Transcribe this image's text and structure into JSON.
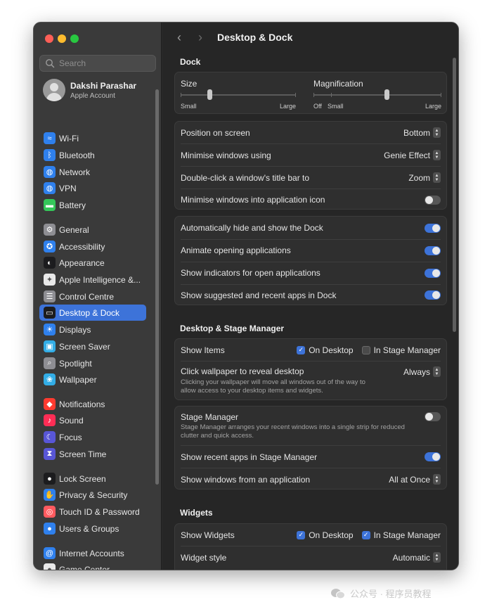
{
  "sidebar": {
    "search_placeholder": "Search",
    "account": {
      "name": "Dakshi Parashar",
      "subtitle": "Apple Account"
    },
    "items": [
      {
        "label": "Wi-Fi",
        "icon": "wifi-icon",
        "color": "#2f80ed"
      },
      {
        "label": "Bluetooth",
        "icon": "bluetooth-icon",
        "color": "#2f80ed"
      },
      {
        "label": "Network",
        "icon": "globe-icon",
        "color": "#2f80ed"
      },
      {
        "label": "VPN",
        "icon": "vpn-globe-icon",
        "color": "#2f80ed"
      },
      {
        "label": "Battery",
        "icon": "battery-icon",
        "color": "#34c759"
      },
      {
        "label": "General",
        "icon": "gear-icon",
        "color": "#8e8e93"
      },
      {
        "label": "Accessibility",
        "icon": "accessibility-icon",
        "color": "#2f80ed"
      },
      {
        "label": "Appearance",
        "icon": "appearance-icon",
        "color": "#1c1c1e"
      },
      {
        "label": "Apple Intelligence &...",
        "icon": "apple-intelligence-icon",
        "color": "#e9e9e9"
      },
      {
        "label": "Control Centre",
        "icon": "control-centre-icon",
        "color": "#8e8e93"
      },
      {
        "label": "Desktop & Dock",
        "icon": "dock-icon",
        "color": "#1c1c1e",
        "selected": true
      },
      {
        "label": "Displays",
        "icon": "sun-icon",
        "color": "#2f80ed"
      },
      {
        "label": "Screen Saver",
        "icon": "screen-saver-icon",
        "color": "#32ade6"
      },
      {
        "label": "Spotlight",
        "icon": "spotlight-icon",
        "color": "#8e8e93"
      },
      {
        "label": "Wallpaper",
        "icon": "wallpaper-icon",
        "color": "#32ade6"
      },
      {
        "label": "Notifications",
        "icon": "bell-icon",
        "color": "#ff3b30"
      },
      {
        "label": "Sound",
        "icon": "speaker-icon",
        "color": "#ff2d55"
      },
      {
        "label": "Focus",
        "icon": "moon-icon",
        "color": "#5856d6"
      },
      {
        "label": "Screen Time",
        "icon": "hourglass-icon",
        "color": "#5856d6"
      },
      {
        "label": "Lock Screen",
        "icon": "lock-icon",
        "color": "#1c1c1e"
      },
      {
        "label": "Privacy & Security",
        "icon": "hand-icon",
        "color": "#2f80ed"
      },
      {
        "label": "Touch ID & Password",
        "icon": "fingerprint-icon",
        "color": "#ff5a5f"
      },
      {
        "label": "Users & Groups",
        "icon": "users-icon",
        "color": "#2f80ed"
      },
      {
        "label": "Internet Accounts",
        "icon": "at-icon",
        "color": "#2f80ed"
      },
      {
        "label": "Game Center",
        "icon": "game-center-icon",
        "color": "#e9e9e9"
      }
    ]
  },
  "main": {
    "title": "Desktop & Dock",
    "dock": {
      "title": "Dock",
      "size": {
        "label": "Size",
        "min": "Small",
        "max": "Large",
        "value": 0.25
      },
      "magnification": {
        "label": "Magnification",
        "off": "Off",
        "min": "Small",
        "max": "Large",
        "value": 0.57
      },
      "position": {
        "label": "Position on screen",
        "value": "Bottom"
      },
      "minimise_using": {
        "label": "Minimise windows using",
        "value": "Genie Effect"
      },
      "double_click": {
        "label": "Double-click a window's title bar to",
        "value": "Zoom"
      },
      "minimise_into_icon": {
        "label": "Minimise windows into application icon",
        "on": false
      },
      "auto_hide": {
        "label": "Automatically hide and show the Dock",
        "on": true
      },
      "animate": {
        "label": "Animate opening applications",
        "on": true
      },
      "indicators": {
        "label": "Show indicators for open applications",
        "on": true
      },
      "suggested": {
        "label": "Show suggested and recent apps in Dock",
        "on": true
      }
    },
    "stage": {
      "title": "Desktop & Stage Manager",
      "show_items": {
        "label": "Show Items",
        "on_desktop": "On Desktop",
        "on_desktop_checked": true,
        "in_stage": "In Stage Manager",
        "in_stage_checked": false
      },
      "click_wallpaper": {
        "label": "Click wallpaper to reveal desktop",
        "desc": "Clicking your wallpaper will move all windows out of the way to allow access to your desktop items and widgets.",
        "value": "Always"
      },
      "stage_manager": {
        "label": "Stage Manager",
        "desc": "Stage Manager arranges your recent windows into a single strip for reduced clutter and quick access.",
        "on": false
      },
      "recent_apps": {
        "label": "Show recent apps in Stage Manager",
        "on": true
      },
      "windows_from_app": {
        "label": "Show windows from an application",
        "value": "All at Once"
      }
    },
    "widgets": {
      "title": "Widgets",
      "show_widgets": {
        "label": "Show Widgets",
        "on_desktop": "On Desktop",
        "on_desktop_checked": true,
        "in_stage": "In Stage Manager",
        "in_stage_checked": true
      },
      "style": {
        "label": "Widget style",
        "value": "Automatic"
      }
    }
  },
  "watermark": {
    "text": "公众号 · 程序员教程"
  },
  "colors": {
    "accent": "#3d73d9",
    "sidebar_bg": "#3a3a3a",
    "content_bg": "#262626"
  }
}
